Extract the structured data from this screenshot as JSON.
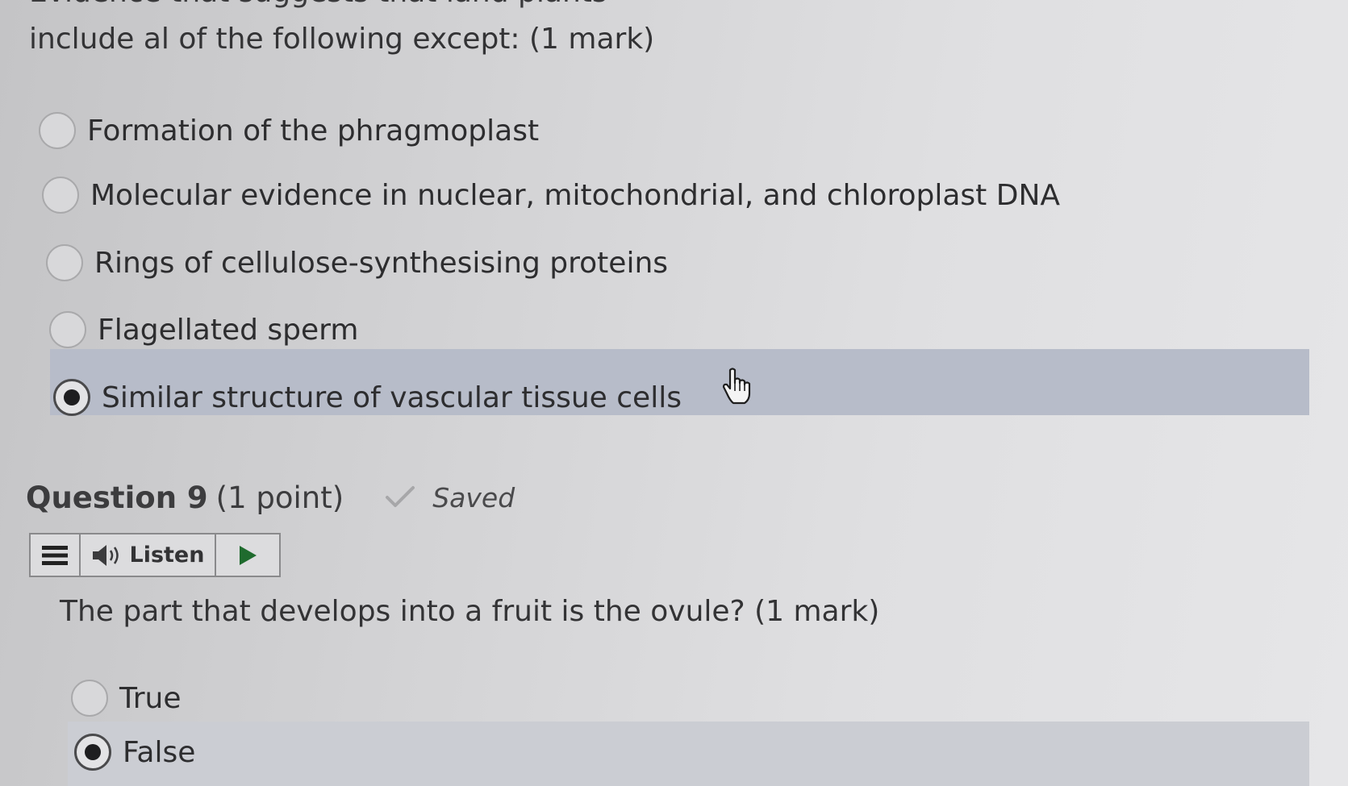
{
  "question8": {
    "prompt_top_partial": "Evidence that suggests that land plants",
    "prompt": "include al of the following except: (1 mark)",
    "options": [
      {
        "label": "Formation of the phragmoplast",
        "selected": false
      },
      {
        "label": "Molecular evidence in nuclear, mitochondrial, and chloroplast DNA",
        "selected": false
      },
      {
        "label": "Rings of cellulose-synthesising proteins",
        "selected": false
      },
      {
        "label": "Flagellated sperm",
        "selected": false
      },
      {
        "label": "Similar structure of vascular tissue cells",
        "selected": true
      }
    ]
  },
  "question9": {
    "title": "Question 9",
    "points": "(1 point)",
    "status": "Saved",
    "toolbar": {
      "listen_label": "Listen"
    },
    "prompt": "The part that develops into a fruit is the ovule? (1 mark)",
    "options": [
      {
        "label": "True",
        "selected": false
      },
      {
        "label": "False",
        "selected": true
      }
    ]
  },
  "colors": {
    "selected_highlight": "#b7bcc9",
    "play_icon": "#1f6b2e",
    "check_icon": "#a7a7a9"
  },
  "icons": [
    "hand-cursor-icon",
    "checkmark-icon",
    "menu-icon",
    "speaker-icon",
    "play-icon"
  ]
}
